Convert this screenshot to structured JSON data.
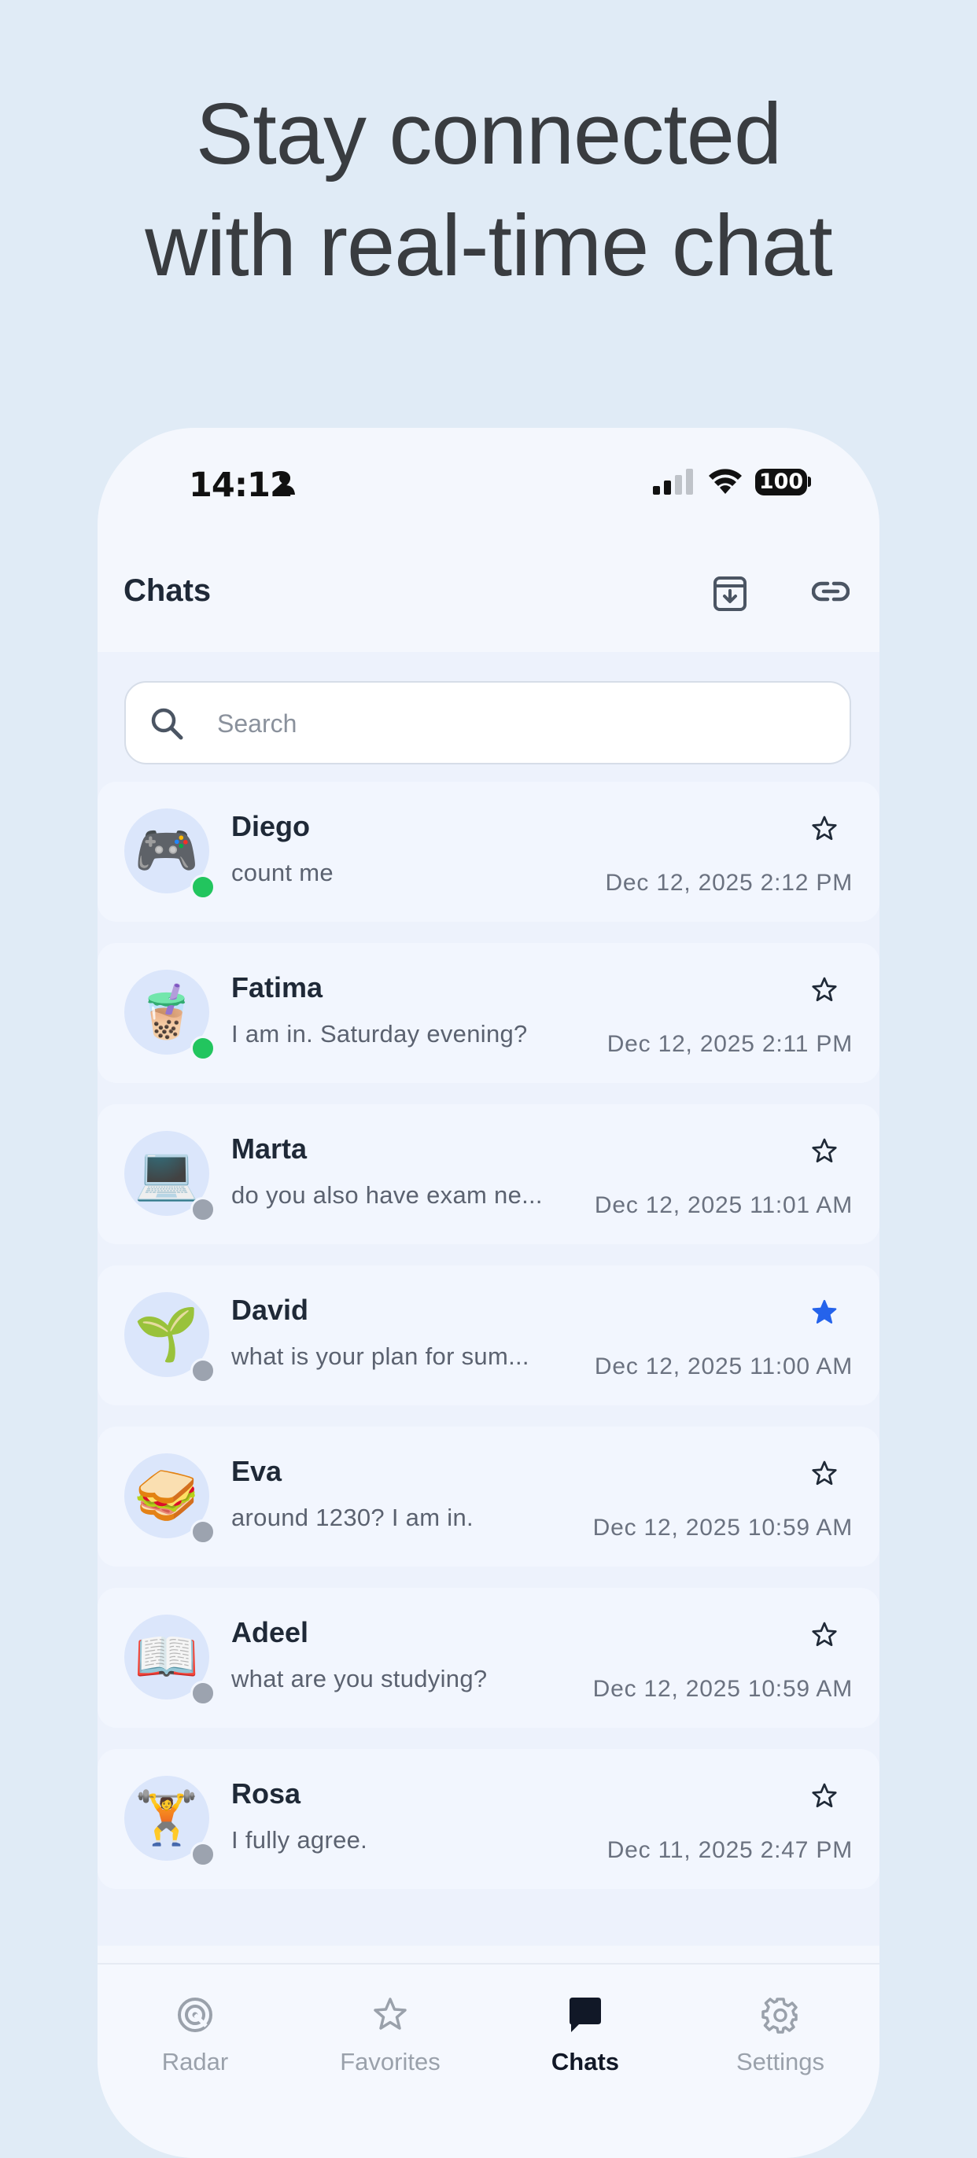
{
  "headline": {
    "line1": "Stay connected",
    "line2": "with real-time chat"
  },
  "status_bar": {
    "time": "14:12",
    "battery": "100"
  },
  "header": {
    "title": "Chats",
    "actions": [
      "archive-icon",
      "link-icon"
    ]
  },
  "search": {
    "placeholder": "Search",
    "value": ""
  },
  "chats": [
    {
      "name": "Diego",
      "message": "count me",
      "time": "Dec 12, 2025 2:12 PM",
      "avatar": "🎮",
      "status": "online",
      "favorite": false
    },
    {
      "name": "Fatima",
      "message": "I am in. Saturday evening?",
      "time": "Dec 12, 2025 2:11 PM",
      "avatar": "🧋",
      "status": "online",
      "favorite": false
    },
    {
      "name": "Marta",
      "message": "do you also have exam ne...",
      "time": "Dec 12, 2025 11:01 AM",
      "avatar": "💻",
      "status": "offline",
      "favorite": false
    },
    {
      "name": "David",
      "message": "what is your plan for sum...",
      "time": "Dec 12, 2025 11:00 AM",
      "avatar": "🌱",
      "status": "offline",
      "favorite": true
    },
    {
      "name": "Eva",
      "message": "around 1230? I am in.",
      "time": "Dec 12, 2025 10:59 AM",
      "avatar": "🥪",
      "status": "offline",
      "favorite": false
    },
    {
      "name": "Adeel",
      "message": "what are you studying?",
      "time": "Dec 12, 2025 10:59 AM",
      "avatar": "📖",
      "status": "offline",
      "favorite": false
    },
    {
      "name": "Rosa",
      "message": "I fully agree.",
      "time": "Dec 11, 2025 2:47 PM",
      "avatar": "🏋️",
      "status": "offline",
      "favorite": false
    }
  ],
  "tabs": [
    {
      "label": "Radar",
      "icon": "radar-icon",
      "active": false
    },
    {
      "label": "Favorites",
      "icon": "star-icon",
      "active": false
    },
    {
      "label": "Chats",
      "icon": "chat-bubble-icon",
      "active": true
    },
    {
      "label": "Settings",
      "icon": "gear-icon",
      "active": false
    }
  ],
  "colors": {
    "background": "#e0ebf6",
    "online": "#22c55e",
    "offline": "#9ca3af",
    "favorite": "#2563eb",
    "active_tab": "#111827",
    "inactive_tab": "#9aa1ab"
  }
}
